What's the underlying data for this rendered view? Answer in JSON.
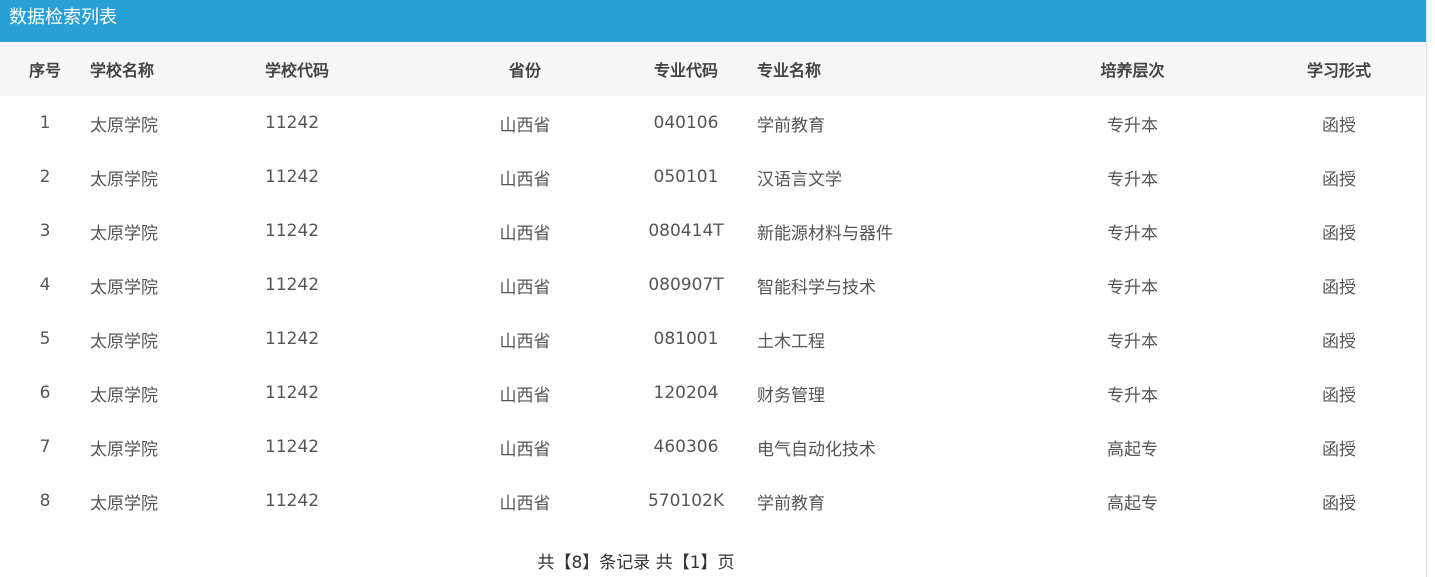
{
  "panel": {
    "title": "数据检索列表"
  },
  "table": {
    "headers": {
      "index": "序号",
      "school_name": "学校名称",
      "school_code": "学校代码",
      "province": "省份",
      "major_code": "专业代码",
      "major_name": "专业名称",
      "level": "培养层次",
      "study_mode": "学习形式"
    },
    "rows": [
      {
        "index": "1",
        "school_name": "太原学院",
        "school_code": "11242",
        "province": "山西省",
        "major_code": "040106",
        "major_name": "学前教育",
        "level": "专升本",
        "study_mode": "函授"
      },
      {
        "index": "2",
        "school_name": "太原学院",
        "school_code": "11242",
        "province": "山西省",
        "major_code": "050101",
        "major_name": "汉语言文学",
        "level": "专升本",
        "study_mode": "函授"
      },
      {
        "index": "3",
        "school_name": "太原学院",
        "school_code": "11242",
        "province": "山西省",
        "major_code": "080414T",
        "major_name": "新能源材料与器件",
        "level": "专升本",
        "study_mode": "函授"
      },
      {
        "index": "4",
        "school_name": "太原学院",
        "school_code": "11242",
        "province": "山西省",
        "major_code": "080907T",
        "major_name": "智能科学与技术",
        "level": "专升本",
        "study_mode": "函授"
      },
      {
        "index": "5",
        "school_name": "太原学院",
        "school_code": "11242",
        "province": "山西省",
        "major_code": "081001",
        "major_name": "土木工程",
        "level": "专升本",
        "study_mode": "函授"
      },
      {
        "index": "6",
        "school_name": "太原学院",
        "school_code": "11242",
        "province": "山西省",
        "major_code": "120204",
        "major_name": "财务管理",
        "level": "专升本",
        "study_mode": "函授"
      },
      {
        "index": "7",
        "school_name": "太原学院",
        "school_code": "11242",
        "province": "山西省",
        "major_code": "460306",
        "major_name": "电气自动化技术",
        "level": "高起专",
        "study_mode": "函授"
      },
      {
        "index": "8",
        "school_name": "太原学院",
        "school_code": "11242",
        "province": "山西省",
        "major_code": "570102K",
        "major_name": "学前教育",
        "level": "高起专",
        "study_mode": "函授"
      }
    ]
  },
  "pagination": {
    "summary": "共【8】条记录 共【1】页"
  },
  "colors": {
    "header_bar": "#2a9fd6",
    "thead_background": "#f7f7f7"
  }
}
